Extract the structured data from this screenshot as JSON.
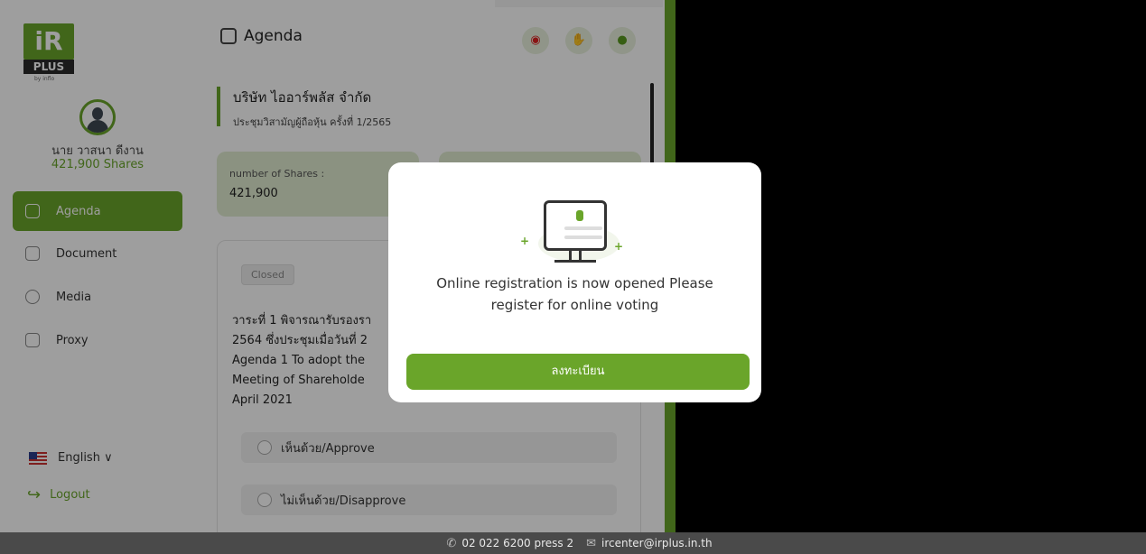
{
  "sidebar": {
    "logo_text": "iR",
    "logo_plus": "PLUS",
    "logo_by": "by inflo",
    "user_name": "นาย วาสนา ดีงาน",
    "user_shares": "421,900 Shares",
    "items": [
      {
        "label": "Agenda",
        "icon": "agenda-icon",
        "active": true
      },
      {
        "label": "Document",
        "icon": "folder-icon",
        "active": false
      },
      {
        "label": "Media",
        "icon": "play-icon",
        "active": false
      },
      {
        "label": "Proxy",
        "icon": "proxy-doc-icon",
        "active": false
      }
    ],
    "language": "English ∨",
    "logout": "Logout"
  },
  "main": {
    "title": "Agenda",
    "company_name": "บริษัท ไออาร์พลัส จำกัด",
    "meeting_title": "ประชุมวิสามัญผู้ถือหุ้น ครั้งที่ 1/2565",
    "shares_label": "number of Shares :",
    "shares_value": "421,900",
    "status": "Closed",
    "agenda_line1": "วาระที่ 1 พิจารณารับรองรา",
    "agenda_line2": "2564 ซึ่งประชุมเมื่อวันที่ 2",
    "agenda_line3": "Agenda 1 To adopt the",
    "agenda_line4": "Meeting of Shareholde",
    "agenda_line5": "April 2021",
    "option_approve": "เห็นด้วย/Approve",
    "option_disapprove": "ไม่เห็นด้วย/Disapprove"
  },
  "modal": {
    "message": "Online registration is now opened Please register for online voting",
    "button": "ลงทะเบียน"
  },
  "footer": {
    "phone": "02 022 6200 press 2",
    "email": "ircenter@irplus.in.th"
  },
  "colors": {
    "accent": "#6aa52a",
    "footer": "#4a4a4a"
  }
}
